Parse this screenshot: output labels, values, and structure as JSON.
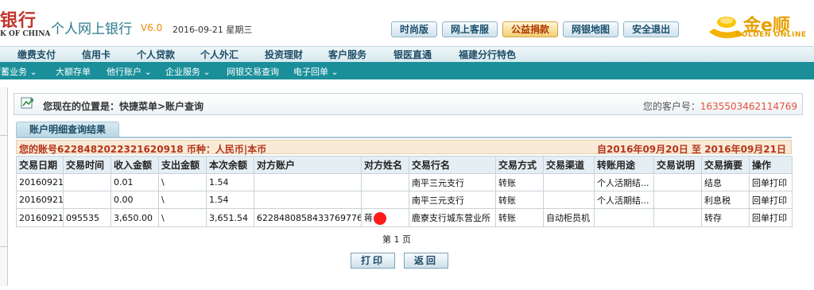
{
  "header": {
    "bank_name": "银行",
    "bank_name_en": "K OF CHINA",
    "system_title": "个人网上银行",
    "version": "V6.0",
    "date": "2016-09-21 星期三",
    "buttons": [
      {
        "label": "时尚版",
        "active": false
      },
      {
        "label": "网上客服",
        "active": false
      },
      {
        "label": "公益捐款",
        "active": true
      },
      {
        "label": "网银地图",
        "active": false
      },
      {
        "label": "安全退出",
        "active": false
      }
    ],
    "logo": {
      "text": "金e顺",
      "sub": "GOLDEN ONLINE"
    }
  },
  "nav_primary": [
    "缴费支付",
    "信用卡",
    "个人贷款",
    "个人外汇",
    "投资理财",
    "客户服务",
    "银医直通",
    "福建分行特色"
  ],
  "nav_secondary": [
    "储蓄业务 ⌄",
    "大额存单",
    "他行账户 ⌄",
    "企业服务 ⌄",
    "网银交易查询",
    "电子回单 ⌄"
  ],
  "location": {
    "label": "您现在的位置是：快捷菜单>账户查询",
    "customer_label": "您的客户号：",
    "customer_no": "1635503462114769"
  },
  "tab": {
    "label": "账户明细查询结果"
  },
  "account": {
    "left": "您的账号6228482022321620918 币种：人民币|本币",
    "right": "自2016年09月20日  至  2016年09月21日"
  },
  "table": {
    "headers": [
      "交易日期",
      "交易时间",
      "收入金额",
      "支出金额",
      "本次余额",
      "对方账户",
      "对方姓名",
      "交易行名",
      "交易方式",
      "交易渠道",
      "转账用途",
      "交易说明",
      "交易摘要",
      "操作"
    ],
    "rows": [
      [
        "20160921",
        "",
        "0.01",
        "\\",
        "1.54",
        "",
        "",
        "南平三元支行",
        "转账",
        "",
        "个人活期结...",
        "",
        "结息",
        "回单打印"
      ],
      [
        "20160921",
        "",
        "0.00",
        "\\",
        "1.54",
        "",
        "",
        "南平三元支行",
        "转账",
        "",
        "个人活期结...",
        "",
        "利息税",
        "回单打印"
      ],
      [
        "20160921",
        "095535",
        "3,650.00",
        "\\",
        "3,651.54",
        "6228480858433769776",
        "蒋",
        "鹿寮支行城东营业所",
        "转账",
        "自动柜员机",
        "",
        "",
        "转存",
        "回单打印"
      ]
    ]
  },
  "pagination": {
    "label": "第 1 页"
  },
  "actions": {
    "print": "打印",
    "back": "返回"
  },
  "colors": {
    "teal_nav": "#1a8f9a",
    "accent_red": "#b4361b",
    "logo_gold": "#e8a000"
  }
}
